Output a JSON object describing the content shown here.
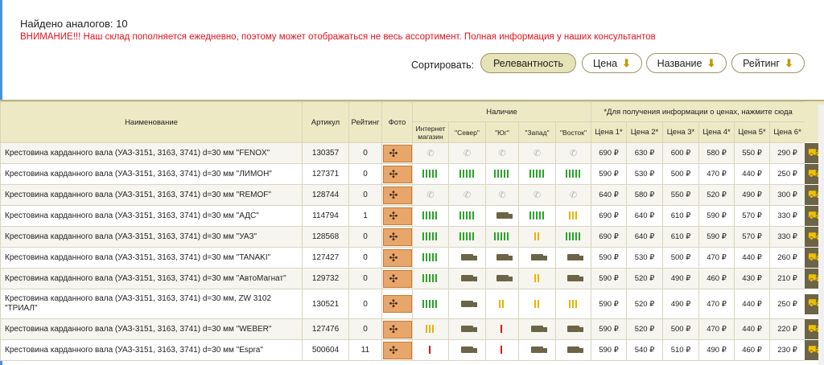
{
  "found_text": "Найдено аналогов: 10",
  "warning_text": "ВНИМАНИЕ!!! Наш склад пополняется ежедневно, поэтому может отображаться не весь ассортимент. Полная информация у наших консультантов",
  "sort": {
    "label": "Сортировать:",
    "buttons": [
      {
        "label": "Релевантность",
        "active": true,
        "arrow": ""
      },
      {
        "label": "Цена",
        "active": false,
        "arrow": "⬇"
      },
      {
        "label": "Название",
        "active": false,
        "arrow": "⬇"
      },
      {
        "label": "Рейтинг",
        "active": false,
        "arrow": "⬇"
      }
    ]
  },
  "table": {
    "headers": {
      "name": "Наименование",
      "article": "Артикул",
      "rating": "Рейтинг",
      "photo": "Фото",
      "availability": "Наличие",
      "price_note": "*Для получения информации о ценах, нажмите сюда",
      "stores": [
        "Интернет магазин",
        "\"Север\"",
        "\"Юг\"",
        "\"Запад\"",
        "\"Восток\""
      ],
      "prices": [
        "Цена 1*",
        "Цена 2*",
        "Цена 3*",
        "Цена 4*",
        "Цена 5*",
        "Цена 6*"
      ]
    },
    "rows": [
      {
        "name": "Крестовина карданного вала (УАЗ-3151, 3163, 3741) d=30 мм \"FENOX\"",
        "article": "130357",
        "rating": "0",
        "avail": [
          "phone",
          "phone",
          "phone",
          "phone",
          "phone"
        ],
        "prices": [
          "690 ₽",
          "630 ₽",
          "600 ₽",
          "580 ₽",
          "550 ₽",
          "290 ₽"
        ]
      },
      {
        "name": "Крестовина карданного вала (УАЗ-3151, 3163, 3741) d=30 мм \"ЛИМОН\"",
        "article": "127371",
        "rating": "0",
        "avail": [
          "g5",
          "g5",
          "g5",
          "g5",
          "g5"
        ],
        "prices": [
          "590 ₽",
          "530 ₽",
          "500 ₽",
          "470 ₽",
          "440 ₽",
          "250 ₽"
        ]
      },
      {
        "name": "Крестовина карданного вала (УАЗ-3151, 3163, 3741) d=30 мм \"REMOF\"",
        "article": "128744",
        "rating": "0",
        "avail": [
          "phone",
          "phone",
          "phone",
          "phone",
          "phone"
        ],
        "prices": [
          "640 ₽",
          "580 ₽",
          "550 ₽",
          "520 ₽",
          "490 ₽",
          "300 ₽"
        ]
      },
      {
        "name": "Крестовина карданного вала (УАЗ-3151, 3163, 3741) d=30 мм \"АДС\"",
        "article": "114794",
        "rating": "1",
        "avail": [
          "g5",
          "g5",
          "truck",
          "g5",
          "y3"
        ],
        "prices": [
          "690 ₽",
          "640 ₽",
          "610 ₽",
          "590 ₽",
          "570 ₽",
          "330 ₽"
        ]
      },
      {
        "name": "Крестовина карданного вала (УАЗ-3151, 3163, 3741) d=30 мм \"УАЗ\"",
        "article": "128568",
        "rating": "0",
        "avail": [
          "g5",
          "g5",
          "g5",
          "y2",
          "g5"
        ],
        "prices": [
          "690 ₽",
          "640 ₽",
          "610 ₽",
          "590 ₽",
          "570 ₽",
          "330 ₽"
        ]
      },
      {
        "name": "Крестовина карданного вала (УАЗ-3151, 3163, 3741) d=30 мм \"TANAKI\"",
        "article": "127427",
        "rating": "0",
        "avail": [
          "g5",
          "truck",
          "truck",
          "truck",
          "truck"
        ],
        "prices": [
          "590 ₽",
          "530 ₽",
          "500 ₽",
          "470 ₽",
          "440 ₽",
          "260 ₽"
        ]
      },
      {
        "name": "Крестовина карданного вала (УАЗ-3151, 3163, 3741) d=30 мм \"АвтоМагнат\"",
        "article": "129732",
        "rating": "0",
        "avail": [
          "g5",
          "truck",
          "truck",
          "y2",
          "truck"
        ],
        "prices": [
          "590 ₽",
          "520 ₽",
          "490 ₽",
          "460 ₽",
          "430 ₽",
          "210 ₽"
        ]
      },
      {
        "name": "Крестовина карданного вала (УАЗ-3151, 3163, 3741) d=30 мм, ZW 3102 \"ТРИАЛ\"",
        "article": "130521",
        "rating": "0",
        "tall": true,
        "avail": [
          "g5",
          "truck",
          "y2",
          "y2",
          "y3"
        ],
        "prices": [
          "590 ₽",
          "520 ₽",
          "490 ₽",
          "470 ₽",
          "440 ₽",
          "250 ₽"
        ]
      },
      {
        "name": "Крестовина карданного вала (УАЗ-3151, 3163, 3741) d=30 мм \"WEBER\"",
        "article": "127476",
        "rating": "0",
        "avail": [
          "y3",
          "truck",
          "r1",
          "truck",
          "truck"
        ],
        "prices": [
          "590 ₽",
          "520 ₽",
          "500 ₽",
          "470 ₽",
          "440 ₽",
          "220 ₽"
        ]
      },
      {
        "name": "Крестовина карданного вала (УАЗ-3151, 3163, 3741) d=30 мм \"Espra\"",
        "article": "500604",
        "rating": "11",
        "avail": [
          "r1",
          "truck",
          "r1",
          "truck",
          "truck"
        ],
        "prices": [
          "590 ₽",
          "540 ₽",
          "510 ₽",
          "490 ₽",
          "460 ₽",
          "230 ₽"
        ]
      }
    ]
  },
  "icons": {
    "cart": "shopping-cart-icon",
    "phone": "phone-icon",
    "truck": "truck-icon",
    "photo": "product-thumbnail"
  },
  "colors": {
    "header_bg": "#ece9c4",
    "cart_bg": "#6b6447",
    "warning": "#e0141e",
    "in_stock": "#2aa52a",
    "low_stock": "#f0b000",
    "critical_stock": "#e01010"
  }
}
